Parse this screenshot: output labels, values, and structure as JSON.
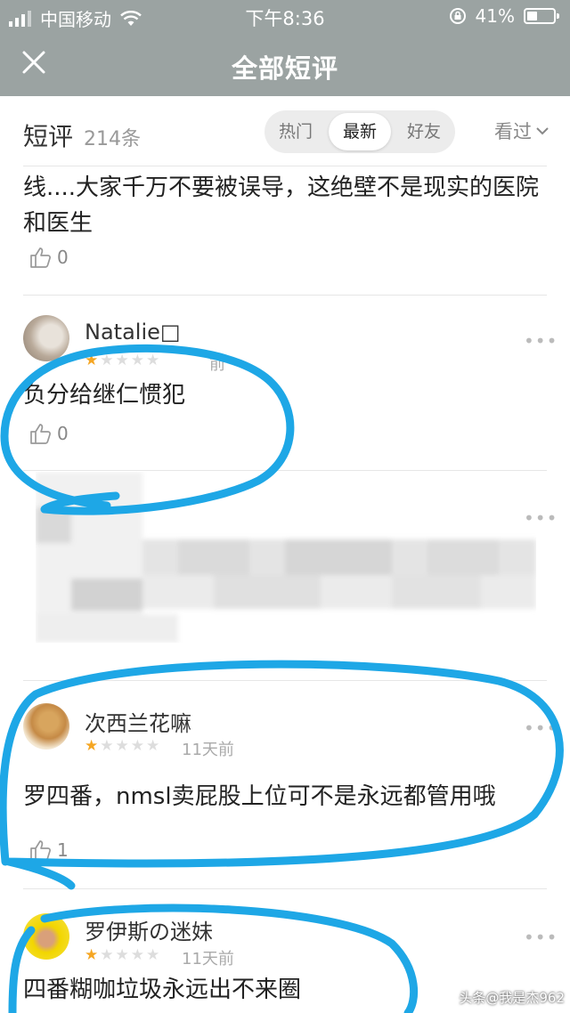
{
  "status_bar": {
    "carrier": "中国移动",
    "time": "下午8:36",
    "battery_pct": "41%",
    "battery_level": 0.41,
    "icons": [
      "signal-icon",
      "wifi-icon",
      "rotation-lock-icon",
      "battery-icon"
    ]
  },
  "nav": {
    "title": "全部短评",
    "close_icon": "close-icon"
  },
  "header": {
    "title": "短评",
    "count": "214条",
    "tabs": [
      {
        "label": "热门",
        "active": false
      },
      {
        "label": "最新",
        "active": true
      },
      {
        "label": "好友",
        "active": false
      }
    ],
    "filter_label": "看过"
  },
  "comments": [
    {
      "text": "线....大家千万不要被误导，这绝壁不是现实的医院和医生",
      "likes": "0"
    },
    {
      "user": "Natalie□",
      "rating": 1,
      "date": "前",
      "text": "负分给继仁惯犯",
      "likes": "0"
    },
    {
      "blurred": true
    },
    {
      "user": "次西兰花嘛",
      "rating": 1,
      "date": "11天前",
      "text": "罗四番，nmsl卖屁股上位可不是永远都管用哦",
      "likes": "1"
    },
    {
      "user": "罗伊斯の迷妹",
      "rating": 1,
      "date": "11天前",
      "text": "四番糊咖垃圾永远出不来圈"
    }
  ],
  "more_label": "•••",
  "watermark": "头条@我是杰962",
  "colors": {
    "nav_bg": "#9ba3a2",
    "star": "#f5a623",
    "annotation": "#1ea7e6"
  }
}
